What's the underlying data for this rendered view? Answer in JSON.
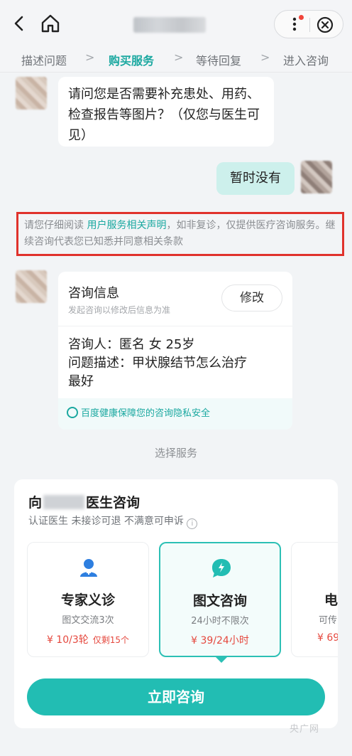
{
  "header": {
    "back_icon": "chevron-left-icon",
    "home_icon": "home-icon",
    "more_icon": "more-vertical-icon",
    "close_icon": "close-circle-icon",
    "badge_color": "#f0443a"
  },
  "steps": [
    {
      "label": "描述问题",
      "active": false
    },
    {
      "label": "购买服务",
      "active": true
    },
    {
      "label": "等待回复",
      "active": false
    },
    {
      "label": "进入咨询",
      "active": false
    }
  ],
  "chat": {
    "question": "请问您是否需要补充患处、用药、检查报告等图片？（仅您与医生可见）",
    "reply": "暂时没有"
  },
  "notice": {
    "prefix": "请您仔细阅读 ",
    "link": "用户服务相关声明",
    "suffix": "，如非复诊，仅提供医疗咨询服务。继续咨询代表您已知悉并同意相关条款"
  },
  "consult_info": {
    "title": "咨询信息",
    "subtitle": "发起咨询以修改后信息为准",
    "edit_label": "修改",
    "person": "咨询人：匿名 女 25岁",
    "problem": "问题描述：甲状腺结节怎么治疗",
    "problem_cont": "最好",
    "privacy": "百度健康保障您的咨询隐私安全"
  },
  "select_service_label": "选择服务",
  "service_panel": {
    "title_prefix": "向",
    "title_suffix": "医生咨询",
    "tags": "认证医生  未接诊可退  不满意可申诉",
    "options": [
      {
        "name": "专家义诊",
        "desc": "图文交流3次",
        "price": "¥ 10/3轮",
        "remaining": "仅剩15个",
        "icon": "doctor-icon",
        "selected": false
      },
      {
        "name": "图文咨询",
        "desc": "24小时不限次",
        "price": "¥ 39/24小时",
        "remaining": "",
        "icon": "chat-bubble-icon",
        "selected": true
      },
      {
        "name": "电",
        "desc": "可传",
        "price": "¥ 69",
        "remaining": "",
        "icon": "phone-icon",
        "selected": false
      }
    ],
    "cta": "立即咨询"
  },
  "watermark": "央广网",
  "accent_color": "#22bdb3",
  "price_color": "#e5483e"
}
